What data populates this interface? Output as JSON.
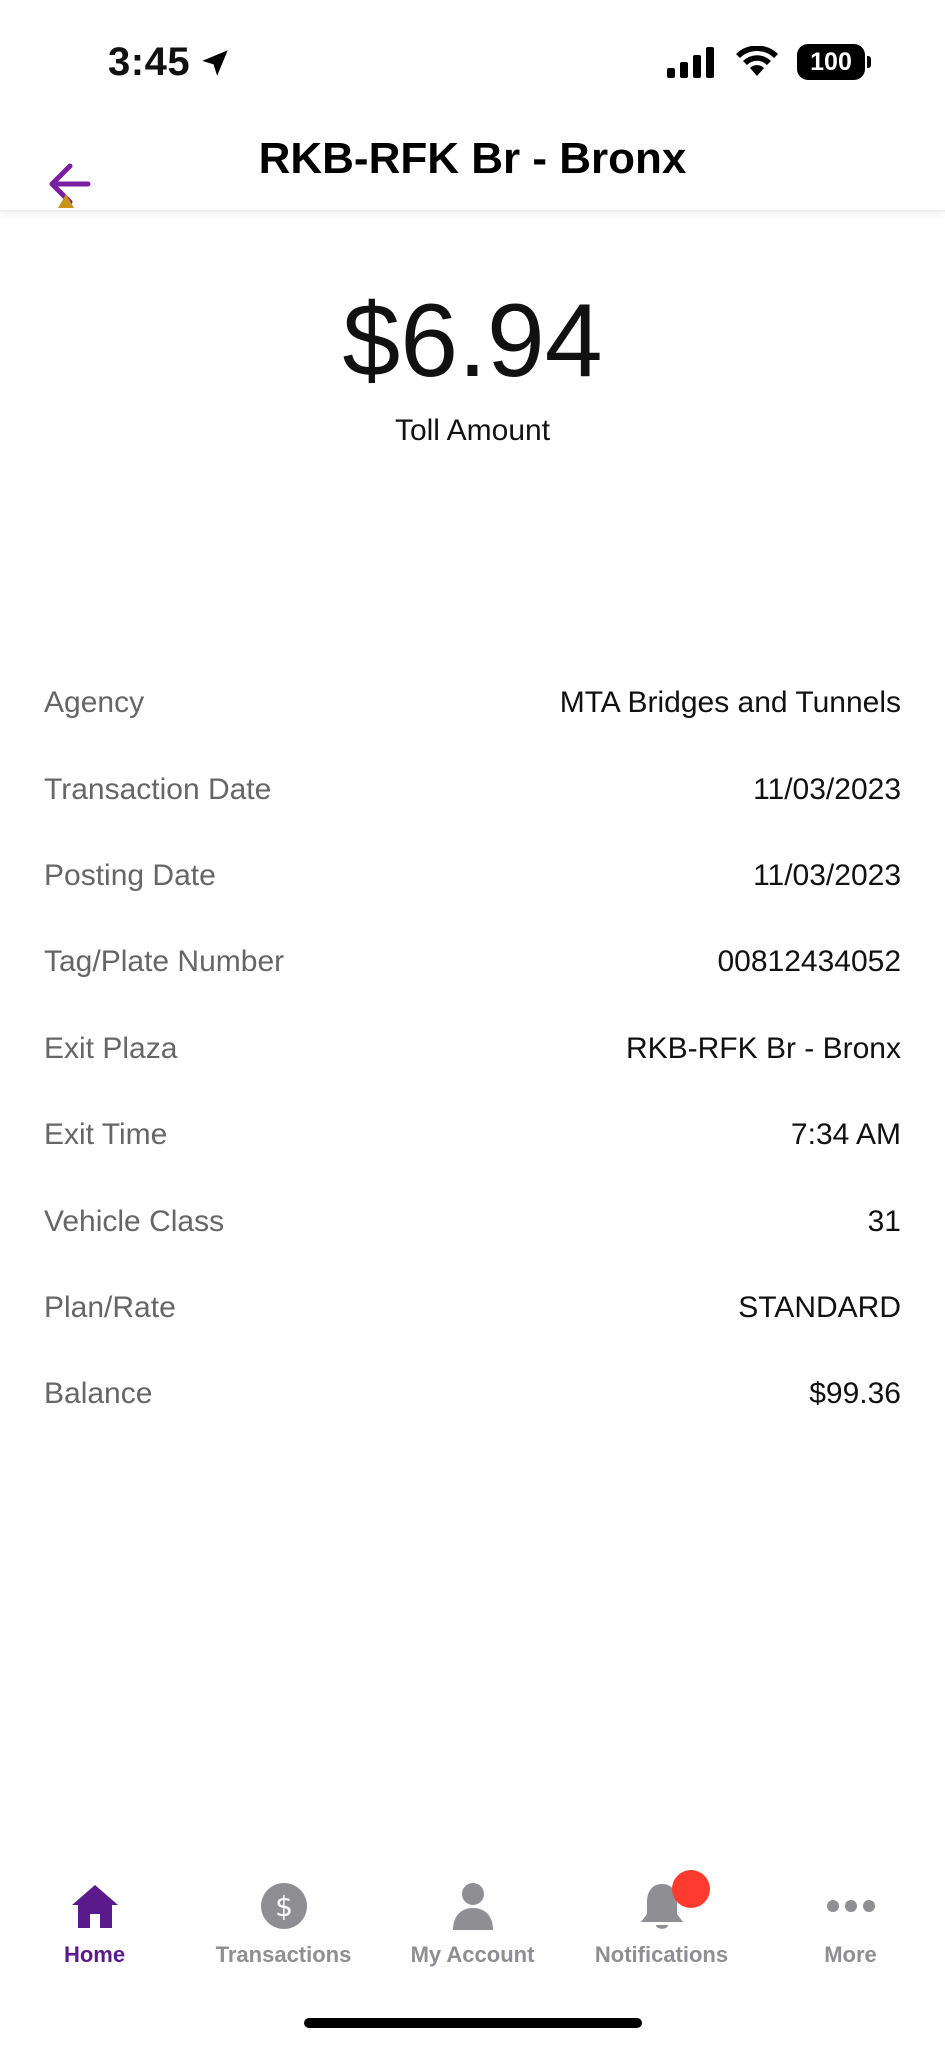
{
  "status_bar": {
    "time": "3:45",
    "battery": "100"
  },
  "header": {
    "title": "RKB-RFK Br - Bronx",
    "back_icon": "arrow-left-icon"
  },
  "toll": {
    "amount": "$6.94",
    "label": "Toll Amount"
  },
  "details": [
    {
      "label": "Agency",
      "value": "MTA Bridges and Tunnels"
    },
    {
      "label": "Transaction Date",
      "value": "11/03/2023"
    },
    {
      "label": "Posting Date",
      "value": "11/03/2023"
    },
    {
      "label": "Tag/Plate Number",
      "value": "00812434052"
    },
    {
      "label": "Exit Plaza",
      "value": "RKB-RFK Br - Bronx"
    },
    {
      "label": "Exit Time",
      "value": "7:34 AM"
    },
    {
      "label": "Vehicle Class",
      "value": "31"
    },
    {
      "label": "Plan/Rate",
      "value": "STANDARD"
    },
    {
      "label": "Balance",
      "value": "$99.36"
    }
  ],
  "tab_bar": {
    "items": [
      {
        "label": "Home",
        "icon": "home-icon",
        "active": true
      },
      {
        "label": "Transactions",
        "icon": "dollar-circle-icon",
        "active": false
      },
      {
        "label": "My Account",
        "icon": "person-icon",
        "active": false
      },
      {
        "label": "Notifications",
        "icon": "bell-icon",
        "active": false
      },
      {
        "label": "More",
        "icon": "more-dots-icon",
        "active": false
      }
    ]
  },
  "colors": {
    "accent": "#5b1a8a",
    "inactive": "#8e8e93",
    "badge": "#ff3b30",
    "label_gray": "#666666"
  }
}
